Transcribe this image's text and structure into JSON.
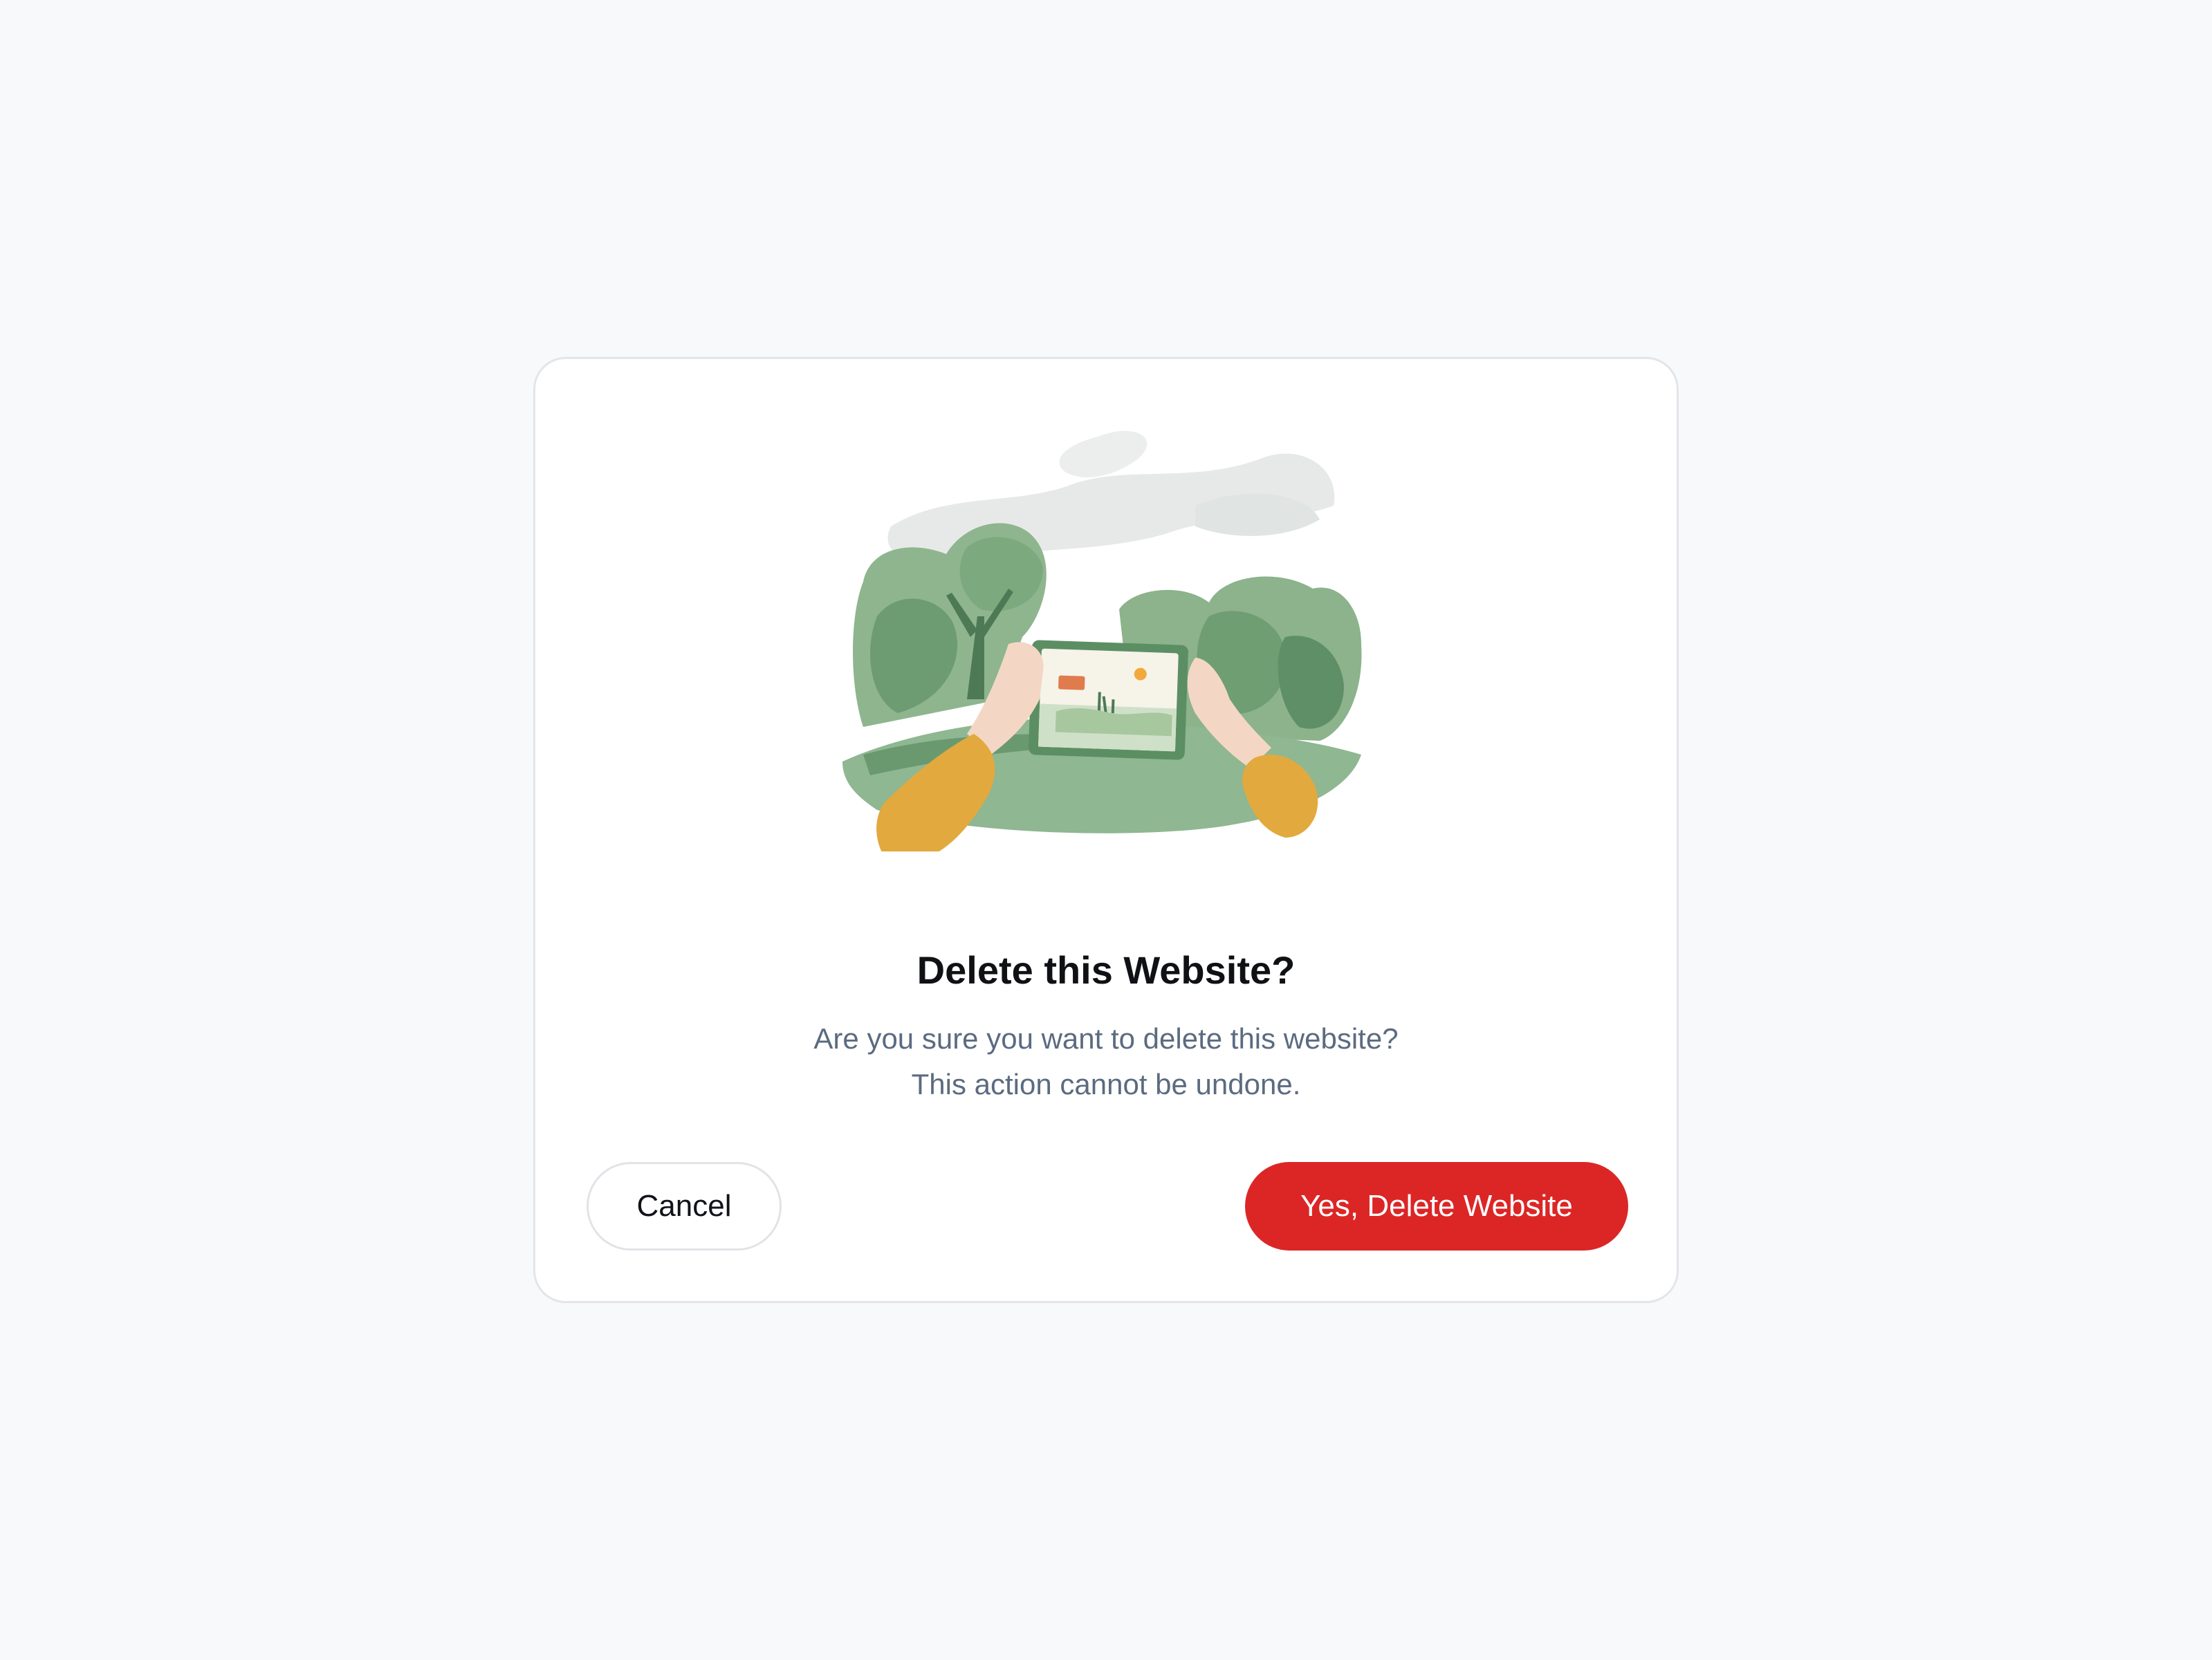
{
  "dialog": {
    "illustration": "hands-holding-picture-in-park",
    "title": "Delete this Website?",
    "message": "Are you sure you want to delete this website? This action cannot be undone.",
    "cancel_label": "Cancel",
    "confirm_label": "Yes, Delete Website"
  },
  "colors": {
    "page_background": "#f8f9fb",
    "danger": "#dc2626",
    "title_text": "#0f1115",
    "body_text": "#5b6b80"
  }
}
